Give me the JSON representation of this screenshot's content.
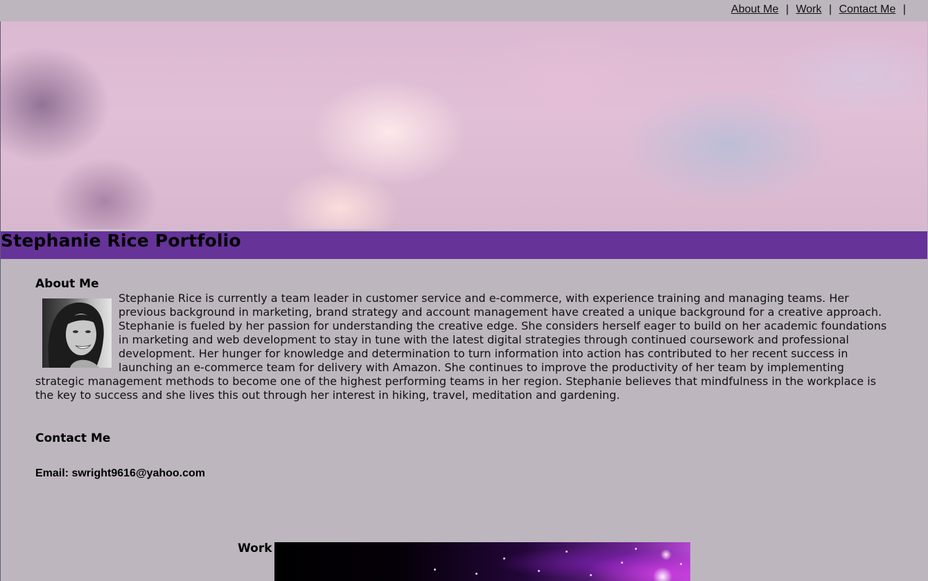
{
  "nav": {
    "links": [
      "About Me",
      "Work",
      "Contact Me"
    ],
    "separator": "|"
  },
  "header": {
    "title": "Stephanie Rice Portfolio",
    "bar_color": "#663399"
  },
  "about": {
    "heading": "About Me",
    "photo_icon": "profile-photo",
    "text": "Stephanie Rice is currently a team leader in customer service and e-commerce, with experience training and managing teams. Her previous background in marketing, brand strategy and account management have created a unique background for a creative approach. Stephanie is fueled by her passion for understanding the creative edge. She considers herself eager to build on her academic foundations in marketing and web development to stay in tune with the latest digital strategies through continued coursework and professional development. Her hunger for knowledge and determination to turn information into action has contributed to her recent success in launching an e-commerce team for delivery with Amazon. She continues to improve the productivity of her team by implementing strategic management methods to become one of the highest performing teams in her region. Stephanie believes that mindfulness in the workplace is the key to success and she lives this out through her interest in hiking, travel, meditation and gardening."
  },
  "contact": {
    "heading": "Contact Me",
    "email_line": "Email: swright9616@yahoo.com"
  },
  "work": {
    "heading": "Work"
  },
  "colors": {
    "page_background": "#bdb6be",
    "text": "#000000"
  }
}
